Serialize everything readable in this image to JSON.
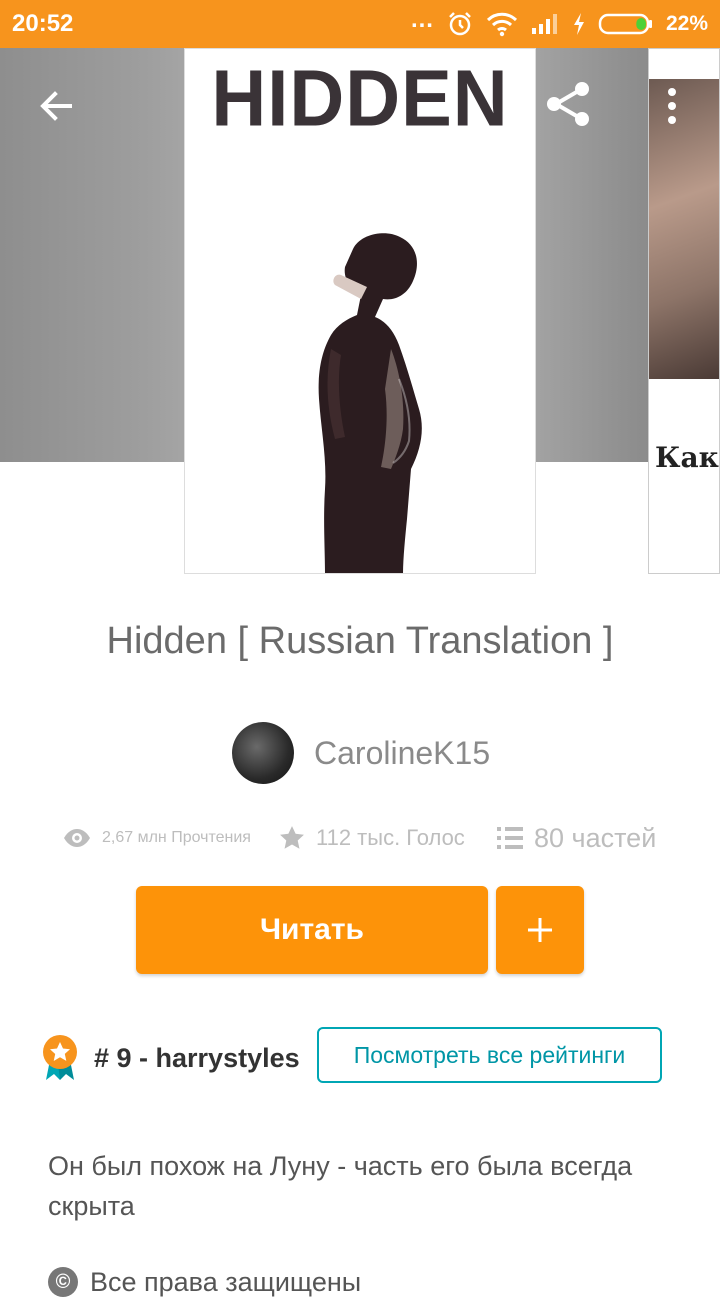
{
  "status_bar": {
    "time": "20:52",
    "dots": "...",
    "battery_percent": "22%",
    "battery_level": 0.22,
    "color": "#f7941d"
  },
  "cover": {
    "title": "HIDDEN",
    "next_cover_text": "Кака"
  },
  "book": {
    "title": "Hidden [ Russian Translation ]",
    "author": "CarolineK15"
  },
  "stats": {
    "reads": "2,67 млн Прочтения",
    "votes": "112 тыс. Голос",
    "parts": "80 частей"
  },
  "actions": {
    "read_label": "Читать",
    "add_label": "+",
    "accent_color": "#fd9309"
  },
  "ranking": {
    "text": "# 9 - harrystyles",
    "button_label": "Посмотреть все рейтинги",
    "button_color": "#00a6b4"
  },
  "description": "Он был похож на Луну - часть его была всегда скрыта",
  "rights": {
    "icon": "©",
    "text": "Все права защищены"
  }
}
